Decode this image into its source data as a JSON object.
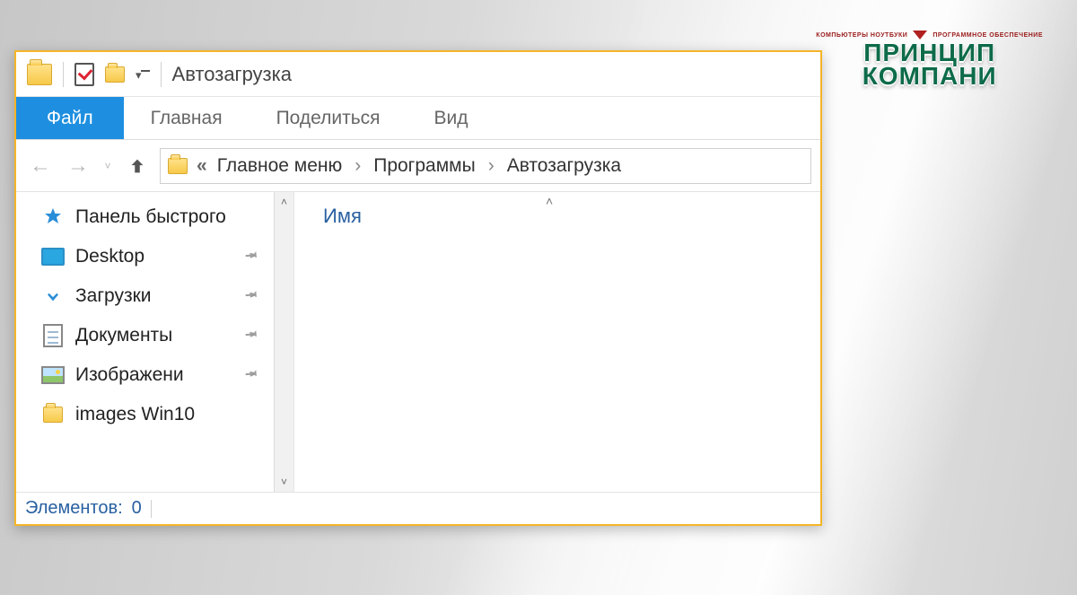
{
  "window_title": "Автозагрузка",
  "ribbon": {
    "file": "Файл",
    "home": "Главная",
    "share": "Поделиться",
    "view": "Вид"
  },
  "breadcrumb": {
    "segments": [
      "Главное меню",
      "Программы",
      "Автозагрузка"
    ]
  },
  "sidebar": {
    "quick_access": "Панель быстрого",
    "items": [
      {
        "label": "Desktop",
        "icon": "desktop",
        "pinned": true
      },
      {
        "label": "Загрузки",
        "icon": "download",
        "pinned": true
      },
      {
        "label": "Документы",
        "icon": "docs",
        "pinned": true
      },
      {
        "label": "Изображени",
        "icon": "image",
        "pinned": true
      },
      {
        "label": "images Win10",
        "icon": "folder",
        "pinned": false
      }
    ]
  },
  "column_header": "Имя",
  "status": {
    "label": "Элементов:",
    "count": "0"
  },
  "brand": {
    "micro_left": "КОМПЬЮТЕРЫ  НОУТБУКИ",
    "micro_right": "ПРОГРАММНОЕ ОБЕСПЕЧЕНИЕ",
    "line1": "ПРИНЦИП",
    "line2": "КОМПАНИ"
  }
}
